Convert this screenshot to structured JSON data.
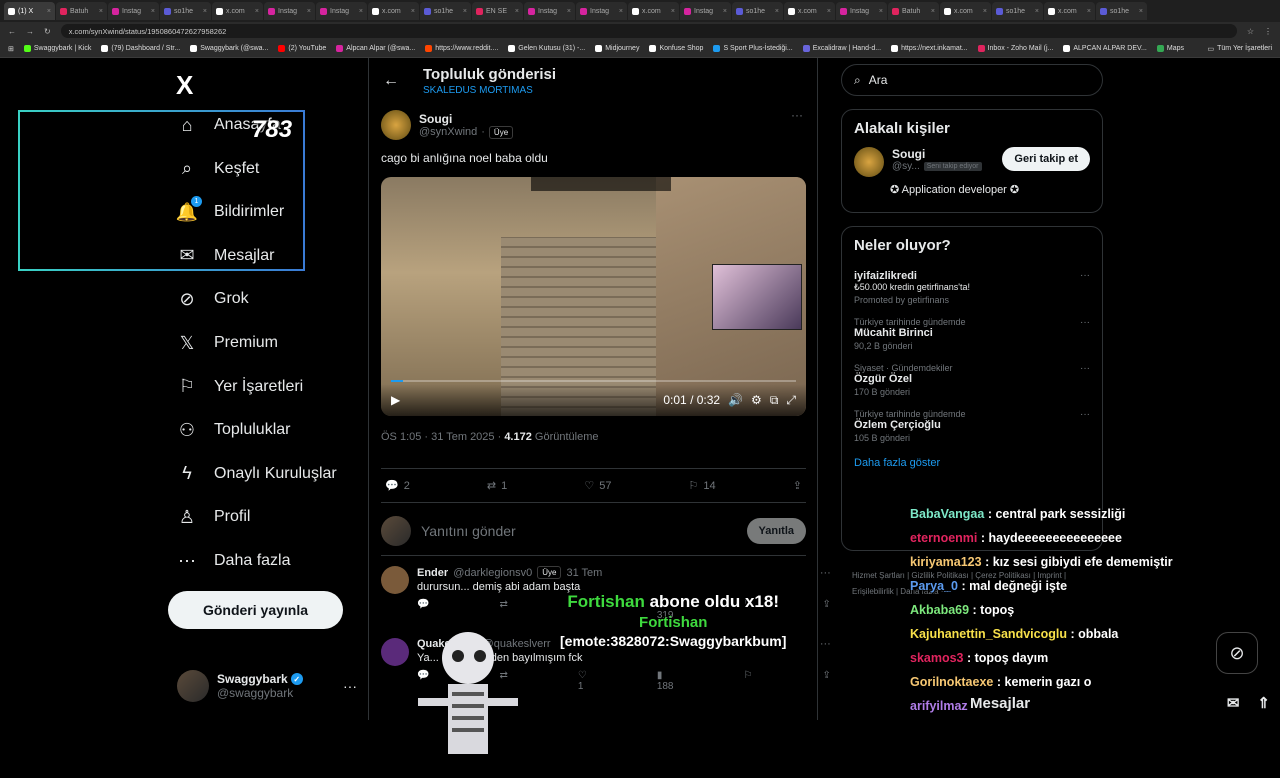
{
  "browser": {
    "tabs": [
      {
        "label": "(1) X",
        "color": "#ffffff",
        "active": true
      },
      {
        "label": "Batuh",
        "color": "#e0245e"
      },
      {
        "label": "Instag",
        "color": "#d6249f"
      },
      {
        "label": "so1he",
        "color": "#5b5bd6"
      },
      {
        "label": "x.com",
        "color": "#ffffff"
      },
      {
        "label": "Instag",
        "color": "#d6249f"
      },
      {
        "label": "Instag",
        "color": "#d6249f"
      },
      {
        "label": "x.com",
        "color": "#ffffff"
      },
      {
        "label": "so1he",
        "color": "#5b5bd6"
      },
      {
        "label": "EN SE",
        "color": "#e0245e"
      },
      {
        "label": "Instag",
        "color": "#d6249f"
      },
      {
        "label": "Instag",
        "color": "#d6249f"
      },
      {
        "label": "x.com",
        "color": "#ffffff"
      },
      {
        "label": "Instag",
        "color": "#d6249f"
      },
      {
        "label": "so1he",
        "color": "#5b5bd6"
      },
      {
        "label": "x.com",
        "color": "#ffffff"
      },
      {
        "label": "Instag",
        "color": "#d6249f"
      },
      {
        "label": "Batuh",
        "color": "#e0245e"
      },
      {
        "label": "x.com",
        "color": "#ffffff"
      },
      {
        "label": "so1he",
        "color": "#5b5bd6"
      },
      {
        "label": "x.com",
        "color": "#ffffff"
      },
      {
        "label": "so1he",
        "color": "#5b5bd6"
      }
    ],
    "url": "x.com/synXwind/status/1950860472627958262",
    "bookmarks": [
      {
        "label": "Swaggybark | Kick",
        "color": "#53fc18"
      },
      {
        "label": "(79) Dashboard / Str...",
        "color": "#ffffff"
      },
      {
        "label": "Swaggybark (@swa...",
        "color": "#ffffff"
      },
      {
        "label": "(2) YouTube",
        "color": "#ff0000"
      },
      {
        "label": "Alpcan Alpar (@swa...",
        "color": "#d6249f"
      },
      {
        "label": "https://www.reddit....",
        "color": "#ff4500"
      },
      {
        "label": "Gelen Kutusu (31) -...",
        "color": "#ffffff"
      },
      {
        "label": "Midjourney",
        "color": "#ffffff"
      },
      {
        "label": "Konfuse Shop",
        "color": "#ffffff"
      },
      {
        "label": "S Sport Plus-İstediği...",
        "color": "#1d9bf0"
      },
      {
        "label": "Excalidraw | Hand-d...",
        "color": "#6965db"
      },
      {
        "label": "https://next.inkamat...",
        "color": "#ffffff"
      },
      {
        "label": "Inbox - Zoho Mail (j...",
        "color": "#e0245e"
      },
      {
        "label": "ALPCAN ALPAR DEV...",
        "color": "#ffffff"
      },
      {
        "label": "Maps",
        "color": "#34a853"
      }
    ],
    "all_bookmarks": "Tüm Yer İşaretleri"
  },
  "nav": {
    "logo": "X",
    "items": [
      {
        "label": "Anasayfa",
        "icon": "home-icon",
        "glyph": "⌂"
      },
      {
        "label": "Keşfet",
        "icon": "search-icon",
        "glyph": "⌕"
      },
      {
        "label": "Bildirimler",
        "icon": "bell-icon",
        "glyph": "🔔",
        "badge": "1"
      },
      {
        "label": "Mesajlar",
        "icon": "mail-icon",
        "glyph": "✉"
      },
      {
        "label": "Grok",
        "icon": "grok-icon",
        "glyph": "⊘"
      },
      {
        "label": "Premium",
        "icon": "x-icon",
        "glyph": "𝕏"
      },
      {
        "label": "Yer İşaretleri",
        "icon": "bookmark-icon",
        "glyph": "⚐"
      },
      {
        "label": "Topluluklar",
        "icon": "communities-icon",
        "glyph": "⚇"
      },
      {
        "label": "Onaylı Kuruluşlar",
        "icon": "lightning-icon",
        "glyph": "ϟ"
      },
      {
        "label": "Profil",
        "icon": "profile-icon",
        "glyph": "♙"
      },
      {
        "label": "Daha fazla",
        "icon": "more-circle-icon",
        "glyph": "⋯"
      }
    ],
    "post_button": "Gönderi yayınla",
    "account": {
      "name": "Swaggybark",
      "handle": "@swaggybark"
    },
    "overlay_number": "783"
  },
  "main": {
    "title": "Topluluk gönderisi",
    "subtitle": "SKALEDUS MORTIMAS",
    "tweet": {
      "name": "Sougi",
      "handle": "@synXwind",
      "member": "Üye",
      "text": "cago bi anlığına noel baba oldu",
      "video_time": "0:01 / 0:32",
      "video_progress": 0.03,
      "time": "ÖS 1:05 · 31 Tem 2025 · ",
      "views": "4.172",
      "views_label": "Görüntüleme",
      "replies": "2",
      "reposts": "1",
      "likes": "57",
      "bookmarks": "14"
    },
    "reply_placeholder": "Yanıtını gönder",
    "reply_button": "Yanıtla",
    "replies": [
      {
        "name": "Ender",
        "handle": "@darklegionsv0",
        "member": "Üye",
        "date": "31 Tem",
        "text": "durursun... demiş abi adam başta",
        "views": "319",
        "color": "#7a5a3a"
      },
      {
        "name": "Quake Iverr",
        "handle": "@quakeslverr",
        "member": "",
        "date": "",
        "text": "Ya... düzeremeden bayılmışım fck",
        "likes": "1",
        "views": "188",
        "color": "#5a2a7a"
      }
    ]
  },
  "sidebar": {
    "search_placeholder": "Ara",
    "relevant_title": "Alakalı kişiler",
    "relevant": {
      "name": "Sougi",
      "handle": "@sy...",
      "follows_you": "Seni takip ediyor",
      "button": "Geri takip et",
      "bio": "✪ Application developer ✪"
    },
    "trending_title": "Neler oluyor?",
    "trends": [
      {
        "category": "",
        "name": "iyifaizlikredi",
        "desc": "₺50.000 kredin getirfinans'ta!",
        "count": "Promoted by getirfinans"
      },
      {
        "category": "Türkiye tarihinde gündemde",
        "name": "Mücahit Birinci",
        "desc": "",
        "count": "90,2 B gönderi"
      },
      {
        "category": "Siyaset · Gündemdekiler",
        "name": "Özgür Özel",
        "desc": "",
        "count": "170 B gönderi"
      },
      {
        "category": "Türkiye tarihinde gündemde",
        "name": "Özlem Çerçioğlu",
        "desc": "",
        "count": "105 B gönderi"
      }
    ],
    "show_more": "Daha fazla göster",
    "footer": "Hizmet Şartları | Gizlilik Politikası | Çerez Politikası | Imprint | Erişilebilirlik | Daha fazla ···"
  },
  "stream_overlay": {
    "chat": [
      {
        "user": "BabaVangaa",
        "color": "#7de8c8",
        "msg": ": central park sessizliği"
      },
      {
        "user": "eternoenmi",
        "color": "#e0245e",
        "msg": ": haydeeeeeeeeeeeeeee"
      },
      {
        "user": "kiriyama123",
        "color": "#f7c873",
        "msg": ": kız sesi gibiydi efe dememiştir"
      },
      {
        "user": "Parya_0",
        "color": "#5b9bf0",
        "msg": ": mal değneği işte"
      },
      {
        "user": "Akbaba69",
        "color": "#7de87d",
        "msg": ": topoş"
      },
      {
        "user": "Kajuhanettin_Sandvicoglu",
        "color": "#f7e04a",
        "msg": ": obbala"
      },
      {
        "user": "skamos3",
        "color": "#e0245e",
        "msg": ": topoş dayım"
      },
      {
        "user": "Gorilnoktaexe",
        "color": "#f7c873",
        "msg": ": kemerin gazı o"
      },
      {
        "user": "arifyilmaz",
        "color": "#b07de8",
        "msg": ""
      }
    ],
    "sub_line1_user": "Fortishan",
    "sub_line1_rest": "abone oldu x18!",
    "sub_line2": "Fortishan",
    "sub_line3": "[emote:3828072:Swaggybarkbum]",
    "messages_bar": "Mesajlar"
  }
}
